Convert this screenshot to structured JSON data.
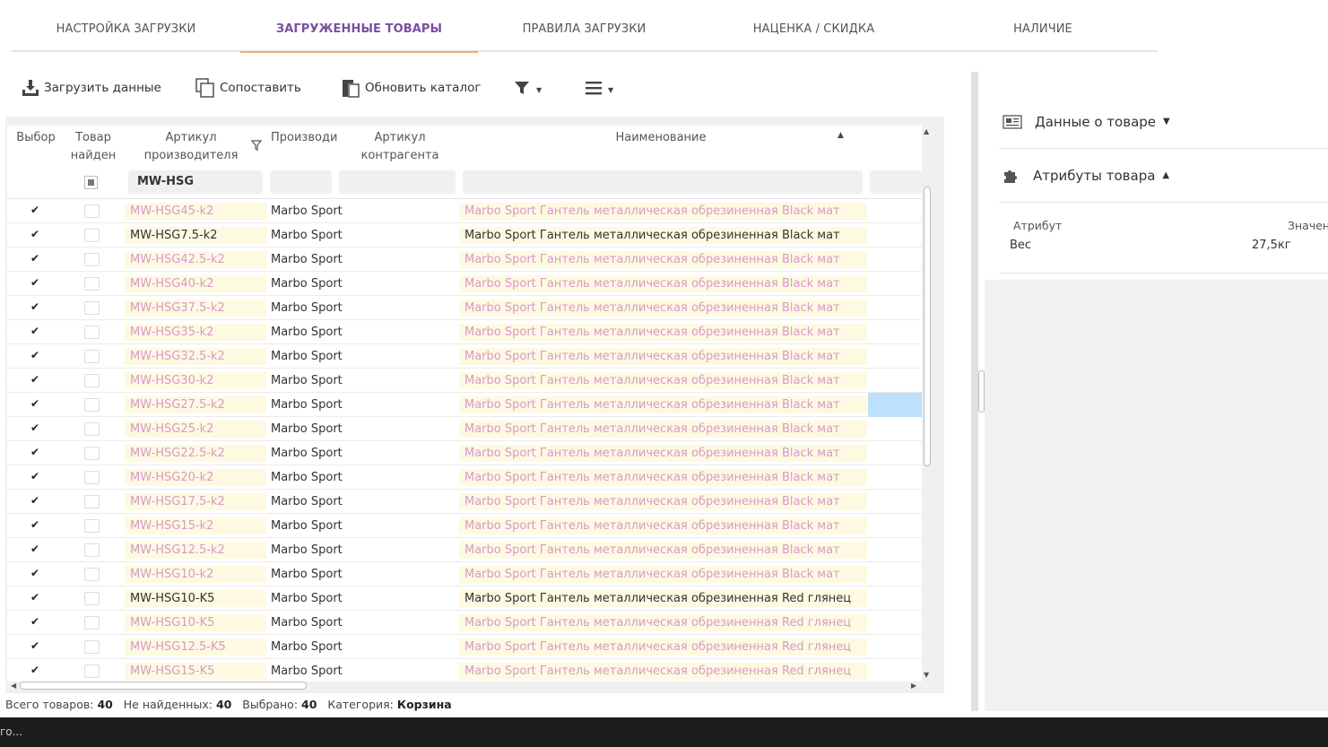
{
  "tabs": [
    {
      "label": "НАСТРОЙКА ЗАГРУЗКИ"
    },
    {
      "label": "ЗАГРУЖЕННЫЕ ТОВАРЫ",
      "active": true
    },
    {
      "label": "ПРАВИЛА ЗАГРУЗКИ"
    },
    {
      "label": "НАЦЕНКА / СКИДКА"
    },
    {
      "label": "НАЛИЧИЕ"
    }
  ],
  "toolbar": {
    "upload_label": "Загрузить данные",
    "match_label": "Сопоставить",
    "update_label": "Обновить каталог"
  },
  "grid": {
    "headers": {
      "select": "Выбор",
      "found_1": "Товар",
      "found_2": "найден",
      "article_1": "Артикул",
      "article_2": "производителя",
      "manufacturer": "Производи",
      "contractor_1": "Артикул",
      "contractor_2": "контрагента",
      "name": "Наименование"
    },
    "filters": {
      "article": "MW-HSG"
    },
    "rows": [
      {
        "article": "MW-HSG45-k2",
        "manufacturer": "Marbo Sport",
        "name": "Marbo Sport Гантель металлическая обрезиненная Black мат",
        "highlight": true
      },
      {
        "article": "MW-HSG7.5-k2",
        "manufacturer": "Marbo Sport",
        "name": "Marbo Sport Гантель металлическая обрезиненная Black мат",
        "highlight": false
      },
      {
        "article": "MW-HSG42.5-k2",
        "manufacturer": "Marbo Sport",
        "name": "Marbo Sport Гантель металлическая обрезиненная Black мат",
        "highlight": true
      },
      {
        "article": "MW-HSG40-k2",
        "manufacturer": "Marbo Sport",
        "name": "Marbo Sport Гантель металлическая обрезиненная Black мат",
        "highlight": true
      },
      {
        "article": "MW-HSG37.5-k2",
        "manufacturer": "Marbo Sport",
        "name": "Marbo Sport Гантель металлическая обрезиненная Black мат",
        "highlight": true
      },
      {
        "article": "MW-HSG35-k2",
        "manufacturer": "Marbo Sport",
        "name": "Marbo Sport Гантель металлическая обрезиненная Black мат",
        "highlight": true
      },
      {
        "article": "MW-HSG32.5-k2",
        "manufacturer": "Marbo Sport",
        "name": "Marbo Sport Гантель металлическая обрезиненная Black мат",
        "highlight": true
      },
      {
        "article": "MW-HSG30-k2",
        "manufacturer": "Marbo Sport",
        "name": "Marbo Sport Гантель металлическая обрезиненная Black мат",
        "highlight": true
      },
      {
        "article": "MW-HSG27.5-k2",
        "manufacturer": "Marbo Sport",
        "name": "Marbo Sport Гантель металлическая обрезиненная Black мат",
        "highlight": true,
        "selected": true
      },
      {
        "article": "MW-HSG25-k2",
        "manufacturer": "Marbo Sport",
        "name": "Marbo Sport Гантель металлическая обрезиненная Black мат",
        "highlight": true
      },
      {
        "article": "MW-HSG22.5-k2",
        "manufacturer": "Marbo Sport",
        "name": "Marbo Sport Гантель металлическая обрезиненная Black мат",
        "highlight": true
      },
      {
        "article": "MW-HSG20-k2",
        "manufacturer": "Marbo Sport",
        "name": "Marbo Sport Гантель металлическая обрезиненная Black мат",
        "highlight": true
      },
      {
        "article": "MW-HSG17.5-k2",
        "manufacturer": "Marbo Sport",
        "name": "Marbo Sport Гантель металлическая обрезиненная Black мат",
        "highlight": true
      },
      {
        "article": "MW-HSG15-k2",
        "manufacturer": "Marbo Sport",
        "name": "Marbo Sport Гантель металлическая обрезиненная Black мат",
        "highlight": true
      },
      {
        "article": "MW-HSG12.5-k2",
        "manufacturer": "Marbo Sport",
        "name": "Marbo Sport Гантель металлическая обрезиненная Black мат",
        "highlight": true
      },
      {
        "article": "MW-HSG10-k2",
        "manufacturer": "Marbo Sport",
        "name": "Marbo Sport Гантель металлическая обрезиненная Black мат",
        "highlight": true
      },
      {
        "article": "MW-HSG10-K5",
        "manufacturer": "Marbo Sport",
        "name": "Marbo Sport Гантель металлическая обрезиненная Red глянец",
        "highlight": false
      },
      {
        "article": "MW-HSG10-K5",
        "manufacturer": "Marbo Sport",
        "name": "Marbo Sport Гантель металлическая обрезиненная Red глянец",
        "highlight": true
      },
      {
        "article": "MW-HSG12.5-K5",
        "manufacturer": "Marbo Sport",
        "name": "Marbo Sport Гантель металлическая обрезиненная Red глянец",
        "highlight": true
      },
      {
        "article": "MW-HSG15-K5",
        "manufacturer": "Marbo Sport",
        "name": "Marbo Sport Гантель металлическая обрезиненная Red глянец",
        "highlight": true
      }
    ]
  },
  "status": {
    "total_label": "Всего товаров:",
    "total_value": "40",
    "notfound_label": "Не найденных:",
    "notfound_value": "40",
    "selected_label": "Выбрано:",
    "selected_value": "40",
    "category_label": "Категория:",
    "category_value": "Корзина"
  },
  "right_panel": {
    "product_data_label": "Данные о товаре",
    "attributes_label": "Атрибуты товара",
    "attr_col": "Атрибут",
    "value_col": "Значен",
    "attr_name": "Вес",
    "attr_value": "27,5кг"
  },
  "taskbar": {
    "text": "го..."
  },
  "colors": {
    "accent": "#7a4fa2",
    "tab_underline": "#f1ad73",
    "highlight_bg": "#fef9e1",
    "highlight_text": "#d79ac9",
    "selection": "#bde0fb"
  }
}
